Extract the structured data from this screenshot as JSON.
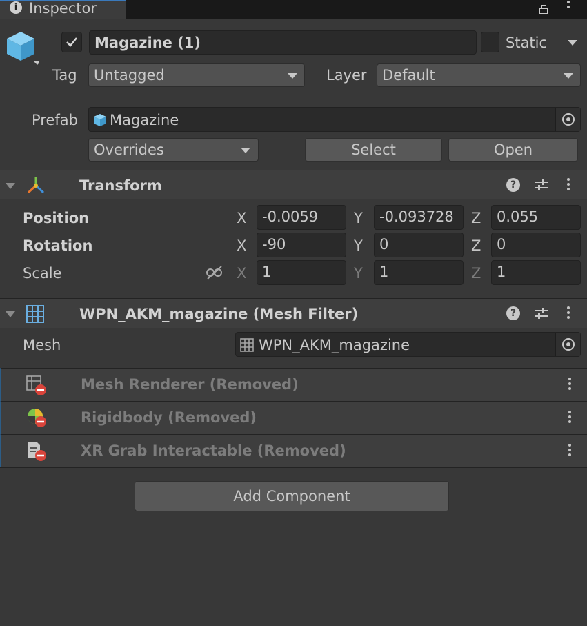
{
  "tab": {
    "title": "Inspector"
  },
  "object": {
    "name": "Magazine (1)",
    "active": true,
    "static_label": "Static",
    "tag_label": "Tag",
    "tag_value": "Untagged",
    "layer_label": "Layer",
    "layer_value": "Default"
  },
  "prefab": {
    "label": "Prefab",
    "value": "Magazine",
    "overrides": "Overrides",
    "select": "Select",
    "open": "Open"
  },
  "transform": {
    "title": "Transform",
    "position_label": "Position",
    "rotation_label": "Rotation",
    "scale_label": "Scale",
    "axis": {
      "x": "X",
      "y": "Y",
      "z": "Z"
    },
    "position": {
      "x": "-0.0059",
      "y": "-0.093728",
      "z": "0.055"
    },
    "rotation": {
      "x": "-90",
      "y": "0",
      "z": "0"
    },
    "scale": {
      "x": "1",
      "y": "1",
      "z": "1"
    }
  },
  "mesh_filter": {
    "title": "WPN_AKM_magazine (Mesh Filter)",
    "mesh_label": "Mesh",
    "mesh_value": "WPN_AKM_magazine"
  },
  "removed": [
    {
      "title": "Mesh Renderer (Removed)",
      "icon": "mesh-renderer-removed-icon"
    },
    {
      "title": "Rigidbody (Removed)",
      "icon": "rigidbody-removed-icon"
    },
    {
      "title": "XR Grab Interactable (Removed)",
      "icon": "script-removed-icon"
    }
  ],
  "add_component": "Add Component",
  "colors": {
    "background": "#383838",
    "header": "#3e3e3e",
    "field": "#2a2a2a",
    "cube": "#5fb7e4",
    "removed_badge": "#d9443b"
  }
}
